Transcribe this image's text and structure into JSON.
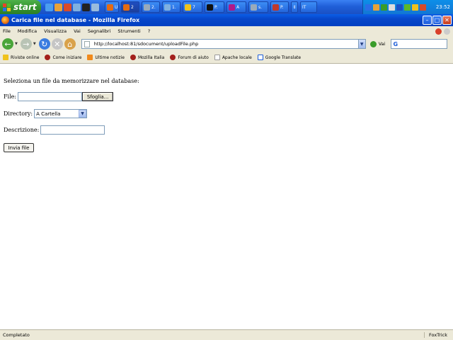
{
  "taskbar": {
    "start_label": "start",
    "tasks": [
      "U",
      "2",
      "2.",
      "1.",
      "7",
      "P.",
      "A",
      "s.",
      "P.",
      "IT"
    ],
    "clock": "23:52"
  },
  "window": {
    "title": "Carica file nel database - Mozilla Firefox"
  },
  "menubar": {
    "items": [
      "File",
      "Modifica",
      "Visualizza",
      "Vai",
      "Segnalibri",
      "Strumenti",
      "?"
    ]
  },
  "navbar": {
    "url": "http://localhost:81/sdocument/uploadFile.php",
    "go_label": "Vai"
  },
  "bookmarks": {
    "items": [
      "Riviste online",
      "Come iniziare",
      "Ultime notizie",
      "Mozilla Italia",
      "Forum di aiuto",
      "Apache locale",
      "Google Translate"
    ]
  },
  "form": {
    "intro": "Seleziona un file da memorizzare nel database:",
    "file_label": "File:",
    "browse_label": "Sfoglia...",
    "directory_label": "Directory:",
    "directory_value": "A Cartella",
    "description_label": "Descrizione:",
    "submit_label": "Invia file"
  },
  "statusbar": {
    "status": "Completato",
    "extension": "FoxTrick"
  },
  "colors": {
    "taskbar": "#1f5fd8",
    "start": "#35952f",
    "chrome": "#ece9d8",
    "titlebar": "#0846c9"
  }
}
